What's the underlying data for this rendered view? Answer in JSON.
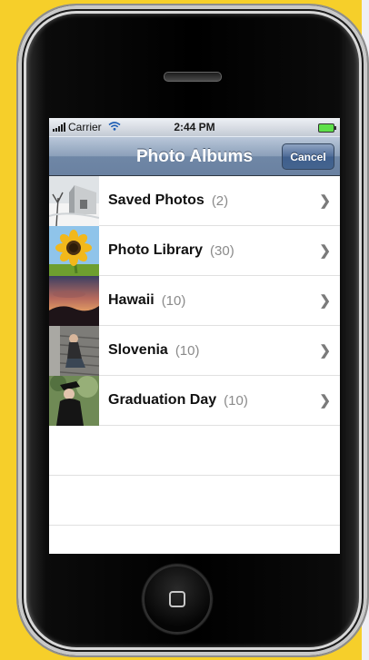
{
  "status_bar": {
    "carrier": "Carrier",
    "time": "2:44 PM"
  },
  "nav": {
    "title": "Photo Albums",
    "cancel_label": "Cancel"
  },
  "albums": [
    {
      "name": "Saved Photos",
      "count": "(2)",
      "thumb": "snowy-barn-thumbnail"
    },
    {
      "name": "Photo Library",
      "count": "(30)",
      "thumb": "sunflower-thumbnail"
    },
    {
      "name": "Hawaii",
      "count": "(10)",
      "thumb": "sunset-thumbnail"
    },
    {
      "name": "Slovenia",
      "count": "(10)",
      "thumb": "person-on-steps-thumbnail"
    },
    {
      "name": "Graduation Day",
      "count": "(10)",
      "thumb": "graduate-thumbnail"
    }
  ],
  "colors": {
    "navbar": "#6f87a6",
    "background": "#f6cf2a"
  }
}
